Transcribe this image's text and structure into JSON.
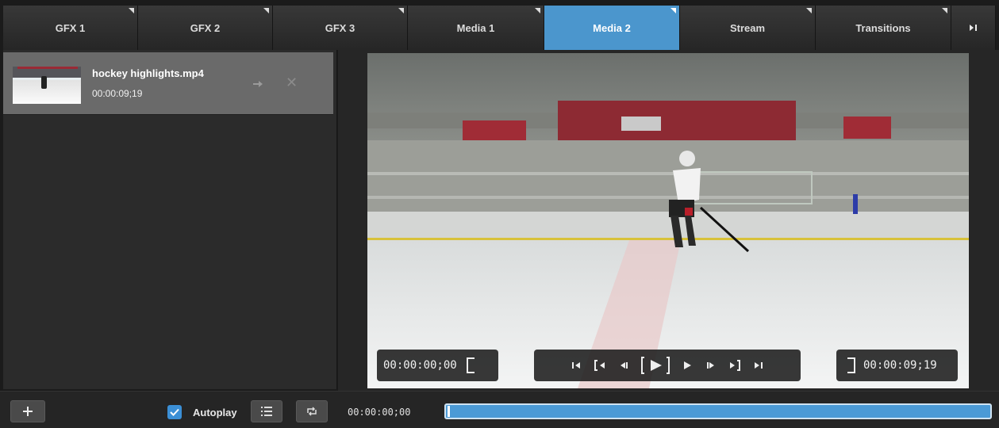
{
  "tabs": [
    {
      "label": "GFX 1",
      "active": false
    },
    {
      "label": "GFX 2",
      "active": false
    },
    {
      "label": "GFX 3",
      "active": false
    },
    {
      "label": "Media 1",
      "active": false
    },
    {
      "label": "Media 2",
      "active": true
    },
    {
      "label": "Stream",
      "active": false
    },
    {
      "label": "Transitions",
      "active": false
    }
  ],
  "tab_end_icon": "skip-to-end-icon",
  "media_list": {
    "items": [
      {
        "title": "hockey highlights.mp4",
        "duration": "00:00:09;19"
      }
    ]
  },
  "player": {
    "in_time": "00:00:00;00",
    "out_time": "00:00:09;19",
    "controls": [
      "skip-to-start-icon",
      "step-back-large-icon",
      "step-back-icon",
      "play-icon",
      "play-small-icon",
      "step-forward-icon",
      "step-forward-large-icon",
      "skip-to-end-icon"
    ]
  },
  "footer": {
    "autoplay_label": "Autoplay",
    "autoplay_checked": true,
    "current_time": "00:00:00;00",
    "progress": 0.0
  },
  "colors": {
    "accent": "#4b96cd",
    "progress": "#4b9ad6",
    "rink_red": "#9a2a35"
  }
}
